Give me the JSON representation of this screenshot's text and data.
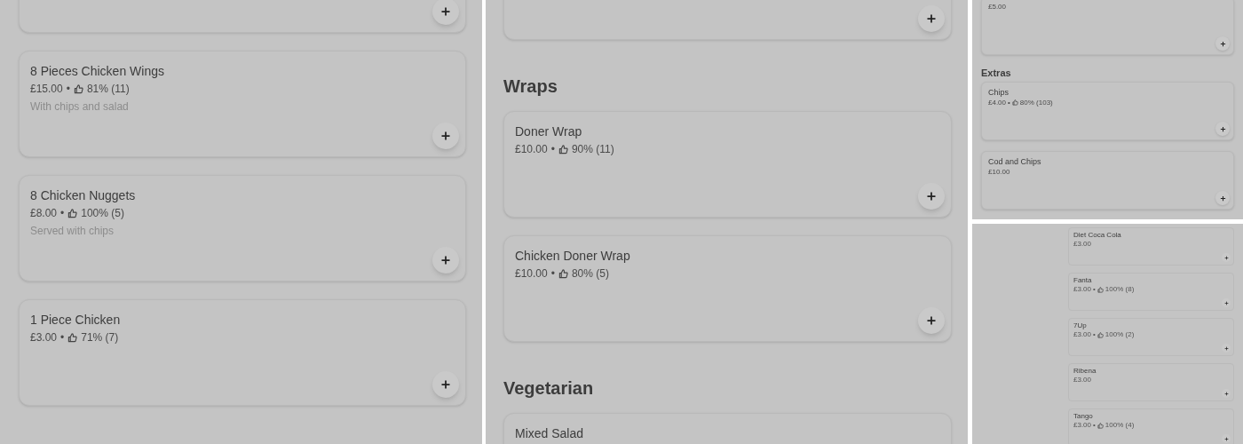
{
  "panels": [
    {
      "items": [
        {
          "kind": "card"
        },
        {
          "kind": "card",
          "name": "8 Pieces Chicken Wings",
          "price": "£15.00",
          "separator": "•",
          "rating": "81% (11)",
          "description": "With chips and salad"
        },
        {
          "kind": "card",
          "name": "8 Chicken Nuggets",
          "price": "£8.00",
          "separator": "•",
          "rating": "100% (5)",
          "description": "Served with chips"
        },
        {
          "kind": "card",
          "name": "1 Piece Chicken",
          "price": "£3.00",
          "separator": "•",
          "rating": "71% (7)"
        }
      ]
    },
    {
      "items": [
        {
          "kind": "card"
        },
        {
          "kind": "heading",
          "text": "Wraps"
        },
        {
          "kind": "card",
          "name": "Doner Wrap",
          "price": "£10.00",
          "separator": "•",
          "rating": "90% (11)"
        },
        {
          "kind": "card",
          "name": "Chicken Doner Wrap",
          "price": "£10.00",
          "separator": "•",
          "rating": "80% (5)"
        },
        {
          "kind": "heading",
          "text": "Vegetarian"
        },
        {
          "kind": "card",
          "name": "Mixed Salad"
        }
      ]
    },
    {
      "items": [
        {
          "kind": "card",
          "price": "£5.00"
        },
        {
          "kind": "heading",
          "text": "Extras"
        },
        {
          "kind": "card",
          "name": "Chips",
          "price": "£4.00",
          "separator": "•",
          "rating": "80% (103)"
        },
        {
          "kind": "card",
          "name": "Cod and Chips",
          "price": "£10.00"
        }
      ]
    },
    {
      "items": [
        {
          "kind": "card",
          "name": "Diet Coca Cola",
          "price": "£3.00"
        },
        {
          "kind": "card",
          "name": "Fanta",
          "price": "£3.00",
          "separator": "•",
          "rating": "100% (8)"
        },
        {
          "kind": "card",
          "name": "7Up",
          "price": "£3.00",
          "separator": "•",
          "rating": "100% (2)"
        },
        {
          "kind": "card",
          "name": "Ribena",
          "price": "£3.00"
        },
        {
          "kind": "card",
          "name": "Tango",
          "price": "£3.00",
          "separator": "•",
          "rating": "100% (4)"
        }
      ]
    }
  ]
}
